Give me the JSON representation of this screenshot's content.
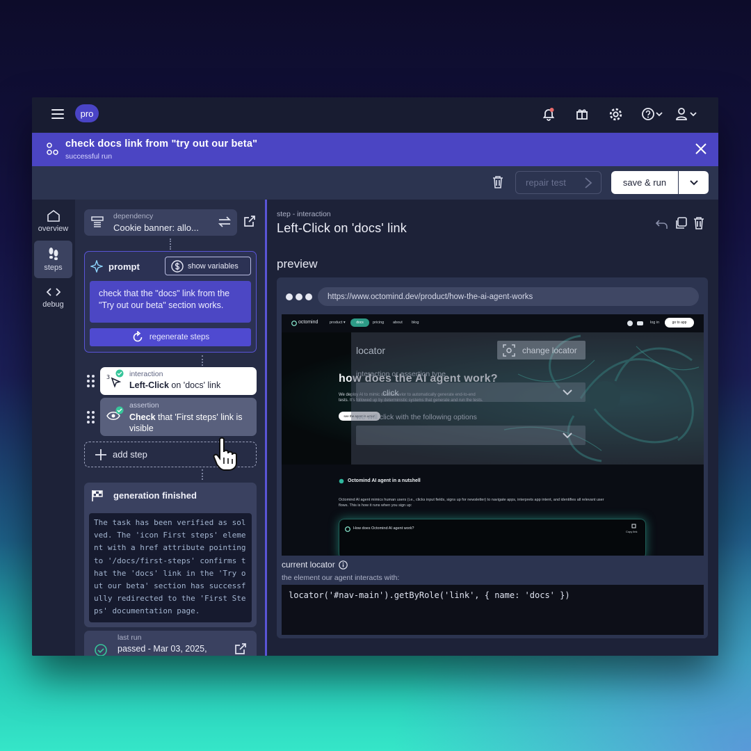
{
  "topbar": {
    "badge": "pro"
  },
  "banner": {
    "title": "check docs link from \"try out our beta\"",
    "subtitle": "successful run"
  },
  "toolbar": {
    "repair_label": "repair test",
    "save_label": "save & run"
  },
  "sidebar": {
    "items": [
      {
        "label": "overview",
        "icon": "home-icon"
      },
      {
        "label": "steps",
        "icon": "footprints-icon",
        "active": true
      },
      {
        "label": "debug",
        "icon": "code-icon"
      }
    ]
  },
  "steps": {
    "dependency": {
      "label": "dependency",
      "value": "Cookie banner: allo..."
    },
    "prompt": {
      "title": "prompt",
      "show_variables": "show variables",
      "text": "check that the \"docs\" link from the \"Try out our beta\" section works.",
      "regenerate": "regenerate steps"
    },
    "items": [
      {
        "type": "interaction",
        "bold": "Left-Click",
        "rest": " on 'docs' link"
      },
      {
        "type": "assertion",
        "bold": "Check",
        "rest": " that 'First steps' link is visible"
      }
    ],
    "add_step": "add step",
    "generation": {
      "title": "generation finished",
      "log": "The task has been verified as sol\nved. The 'icon First steps' eleme\nnt with a href attribute pointing\nto '/docs/first-steps' confirms t\nhat the 'docs' link in the 'Try o\nut our beta' section has successf\nully redirected to the 'First Ste\nps' documentation page."
    },
    "last_run": {
      "label": "last run",
      "value": "passed - Mar 03, 2025,"
    }
  },
  "detail": {
    "kicker": "step - interaction",
    "title": "Left-Click on 'docs' link",
    "preview_label": "preview",
    "url": "https://www.octomind.dev/product/how-the-ai-agent-works",
    "site": {
      "brand": "octomind",
      "nav": [
        "product ▾",
        "docs",
        "pricing",
        "about",
        "blog"
      ],
      "login": "log in",
      "cta": "go to app",
      "hero_title": "how does the AI agent work?",
      "hero_text_a": "We deploy AI to mimic user behavior to automatically generate end-to-end",
      "hero_text_b": "tests. It's followed up by deterministic systems that generate and run the tests.",
      "hero_btn": "see the agent in action",
      "nutshell": "Octomind AI agent in a nutshell",
      "nutshell_body_a": "Octomind AI agent mimics human users (i.e., clicks input fields, signs up for newsletter) to navigate apps, interprets app intent, and identifies all relevant user",
      "nutshell_body_b": "flows. This is how it runs when you sign up:",
      "video_title": "How does Octomind AI agent work?",
      "copy_link": "Copy link"
    },
    "overlay": {
      "locator": "locator",
      "change_locator": "change locator",
      "type_label": "interaction or assertion type",
      "type_value": "click",
      "options_label": "we will click with the following options"
    },
    "current_locator_label": "current locator",
    "locator_desc": "the element our agent interacts with:",
    "locator_code": "locator('#nav-main').getByRole('link', { name: 'docs' })"
  }
}
